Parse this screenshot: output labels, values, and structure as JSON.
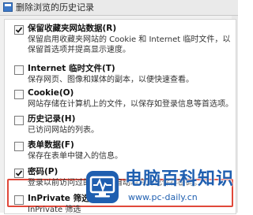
{
  "window": {
    "title": "删除浏览的历史记录"
  },
  "options": [
    {
      "label": "保留收藏夹网站数据(R)",
      "description": "保留启用收藏夹网站的 Cookie 和 Internet 临时文件，以保留首选项并提高显示速度。",
      "checked": true
    },
    {
      "label": "Internet 临时文件(T)",
      "description": "保存网页、图像和媒体的副本，以便快速查看。",
      "checked": false
    },
    {
      "label": "Cookie(O)",
      "description": "网站存储在计算机上的文件，以保存如登录信息等首选项。",
      "checked": false
    },
    {
      "label": "历史记录(H)",
      "description": "已访问网站的列表。",
      "checked": false
    },
    {
      "label": "表单数据(F)",
      "description": "保存在表单中键入的信息。",
      "checked": false
    },
    {
      "label": "密码(P)",
      "description": "登录以前访问过的网站时自动填充的已保存密码。",
      "checked": true
    },
    {
      "label": "InPrivate 筛选数据(I)",
      "description": "InPrivate 筛选",
      "checked": false
    }
  ],
  "watermark": {
    "title": "电脑百科知识",
    "url": "www.pc-daily.cn"
  },
  "colors": {
    "highlight": "#e0483a",
    "accent": "#1f5fb0"
  }
}
